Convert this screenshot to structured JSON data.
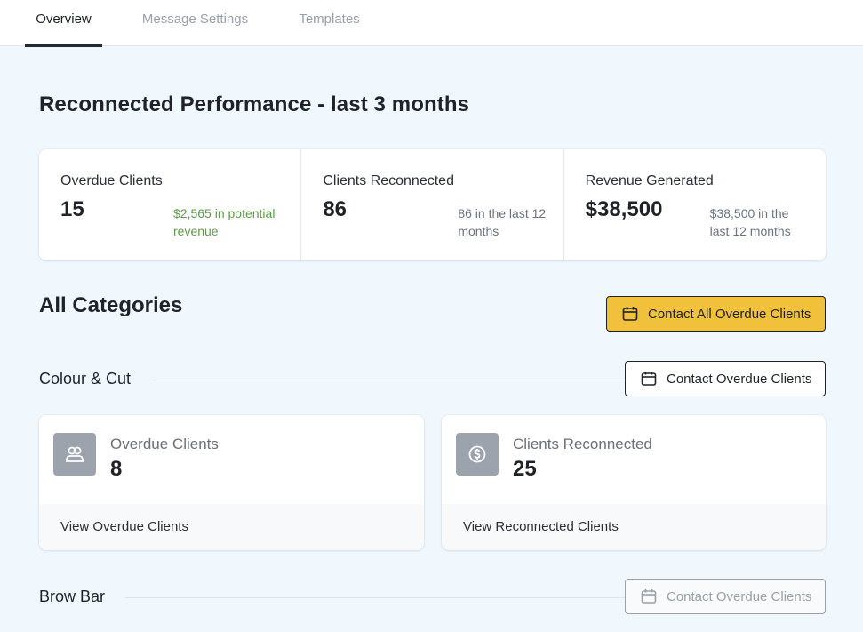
{
  "tabs": [
    {
      "label": "Overview"
    },
    {
      "label": "Message Settings"
    },
    {
      "label": "Templates"
    }
  ],
  "page_title": "Reconnected Performance - last 3 months",
  "stats": [
    {
      "label": "Overdue Clients",
      "value": "15",
      "note": "$2,565 in potential revenue"
    },
    {
      "label": "Clients Reconnected",
      "value": "86",
      "note": "86 in the last 12 months"
    },
    {
      "label": "Revenue Generated",
      "value": "$38,500",
      "note": "$38,500 in the last 12 months"
    }
  ],
  "section_title": "All Categories",
  "contact_all_label": "Contact All Overdue Clients",
  "categories": [
    {
      "name": "Colour & Cut",
      "contact_label": "Contact Overdue Clients",
      "overdue": {
        "label": "Overdue Clients",
        "value": "8",
        "link": "View Overdue Clients"
      },
      "reconnected": {
        "label": "Clients Reconnected",
        "value": "25",
        "link": "View Reconnected Clients"
      }
    },
    {
      "name": "Brow Bar",
      "contact_label": "Contact Overdue Clients"
    }
  ],
  "colors": {
    "background": "#f0f8fe",
    "accent": "#f2c13c",
    "positive": "#5e9a4a",
    "icon_tile": "#9ca3ad"
  },
  "icons": [
    "calendar-icon",
    "users-icon",
    "dollar-circle-icon"
  ]
}
